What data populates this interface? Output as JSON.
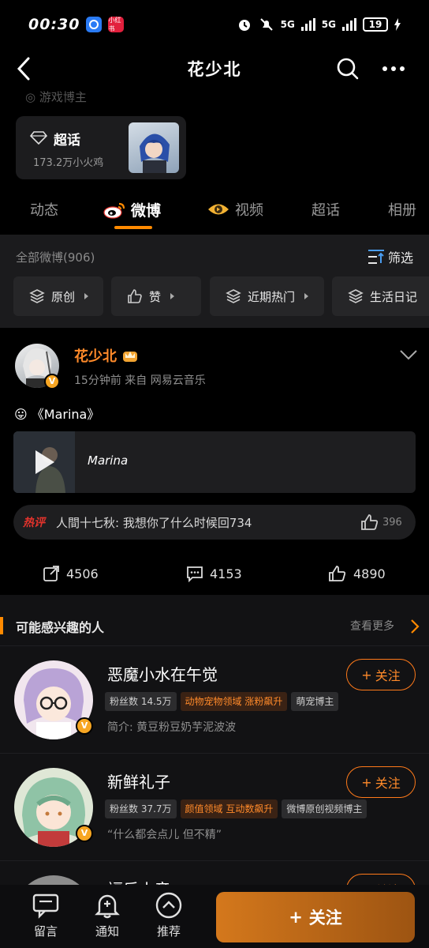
{
  "status_bar": {
    "time": "00:30",
    "app_badge_2": "小红书",
    "network_1": "5G",
    "network_2": "5G",
    "battery": "19"
  },
  "header": {
    "title": "花少北"
  },
  "faded_line": "游戏博主",
  "super_topic": {
    "label": "超话",
    "count": "173.2万小火鸡"
  },
  "tabs": [
    {
      "label": "动态"
    },
    {
      "label": "微博"
    },
    {
      "label": "视频"
    },
    {
      "label": "超话"
    },
    {
      "label": "相册"
    }
  ],
  "filter": {
    "all_label": "全部微博(906)",
    "screen_label": "筛选",
    "chips": [
      {
        "label": "原创",
        "icon": "layers-icon"
      },
      {
        "label": "赞",
        "icon": "thumbs-up-icon"
      },
      {
        "label": "近期热门",
        "icon": "layers-icon"
      },
      {
        "label": "生活日记",
        "icon": "layers-icon"
      }
    ]
  },
  "post": {
    "username": "花少北",
    "meta": "15分钟前 来自 网易云音乐",
    "content": "《Marina》",
    "emoji": "😛",
    "music_title": "Marina",
    "hot_label": "热评",
    "hot_comment": "人間十七秋: 我想你了什么时候回734",
    "hot_comment_likes": "396",
    "reposts": "4506",
    "comments": "4153",
    "likes": "4890"
  },
  "recommend": {
    "title": "可能感兴趣的人",
    "more": "查看更多",
    "people": [
      {
        "name": "恶魔小水在午觉",
        "follow": "关注",
        "tags": [
          {
            "text": "粉丝数 14.5万",
            "style": "gray"
          },
          {
            "text": "动物宠物领域 涨粉飙升",
            "style": "orange"
          },
          {
            "text": "萌宠博主",
            "style": "gray"
          }
        ],
        "intro": "简介: 黄豆粉豆奶芋泥波波"
      },
      {
        "name": "新鲜礼子",
        "follow": "关注",
        "tags": [
          {
            "text": "粉丝数 37.7万",
            "style": "gray"
          },
          {
            "text": "颜值领域 互动数飙升",
            "style": "orange"
          },
          {
            "text": "微博原创视频博主",
            "style": "gray"
          }
        ],
        "intro": "“什么都会点儿 但不精”"
      },
      {
        "name": "福乐小音",
        "follow": "关注"
      }
    ]
  },
  "bottom_bar": {
    "message": "留言",
    "notify": "通知",
    "recommend": "推荐",
    "follow": "关注"
  },
  "colors": {
    "accent": "#ff8a00",
    "background": "#000000",
    "card": "#1e1e20"
  }
}
